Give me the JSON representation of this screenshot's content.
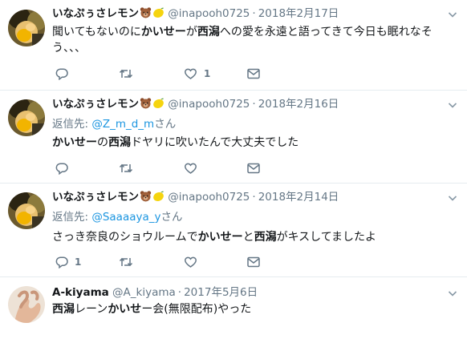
{
  "tweets": [
    {
      "name": "いなぷぅさレモン",
      "emojis": [
        "bear-emoji",
        "lemon-emoji"
      ],
      "handle": "@inapooh0725",
      "dot": "·",
      "date": "2018年2月17日",
      "reply": null,
      "body_parts": [
        {
          "t": "聞いてもないのに",
          "b": false
        },
        {
          "t": "かいせー",
          "b": true
        },
        {
          "t": "が",
          "b": false
        },
        {
          "t": "西潟",
          "b": true
        },
        {
          "t": "への愛を永遠と語ってきて今日も眠れなそう、、、",
          "b": false
        }
      ],
      "counts": {
        "reply": "",
        "retweet": "",
        "like": "1"
      }
    },
    {
      "name": "いなぷぅさレモン",
      "emojis": [
        "bear-emoji",
        "lemon-emoji"
      ],
      "handle": "@inapooh0725",
      "dot": "·",
      "date": "2018年2月16日",
      "reply": {
        "label": "返信先: ",
        "user": "@Z_m_d_m",
        "suffix": "さん"
      },
      "body_parts": [
        {
          "t": "かいせー",
          "b": true
        },
        {
          "t": "の",
          "b": false
        },
        {
          "t": "西潟",
          "b": true
        },
        {
          "t": "ドヤリに吹いたんで大丈夫でした",
          "b": false
        }
      ],
      "counts": {
        "reply": "",
        "retweet": "",
        "like": ""
      }
    },
    {
      "name": "いなぷぅさレモン",
      "emojis": [
        "bear-emoji",
        "lemon-emoji"
      ],
      "handle": "@inapooh0725",
      "dot": "·",
      "date": "2018年2月14日",
      "reply": {
        "label": "返信先: ",
        "user": "@Saaaaya_y",
        "suffix": "さん"
      },
      "body_parts": [
        {
          "t": "さっき奈良のショウルームで",
          "b": false
        },
        {
          "t": "かいせー",
          "b": true
        },
        {
          "t": "と",
          "b": false
        },
        {
          "t": "西潟",
          "b": true
        },
        {
          "t": "がキスしてましたよ",
          "b": false
        }
      ],
      "counts": {
        "reply": "1",
        "retweet": "",
        "like": ""
      }
    },
    {
      "name": "A-kiyama",
      "emojis": [],
      "handle": "@A_kiyama",
      "dot": "·",
      "date": "2017年5月6日",
      "reply": null,
      "body_parts": [
        {
          "t": "西潟",
          "b": true
        },
        {
          "t": "レーン",
          "b": false
        },
        {
          "t": "かいせ",
          "b": true
        },
        {
          "t": "ー会(無限配布)やった",
          "b": false
        }
      ],
      "counts": {
        "reply": "",
        "retweet": "",
        "like": ""
      }
    }
  ],
  "colors": {
    "text": "#14171a",
    "secondary": "#657786",
    "link": "#1b95e0",
    "divider": "#e6ecf0"
  }
}
